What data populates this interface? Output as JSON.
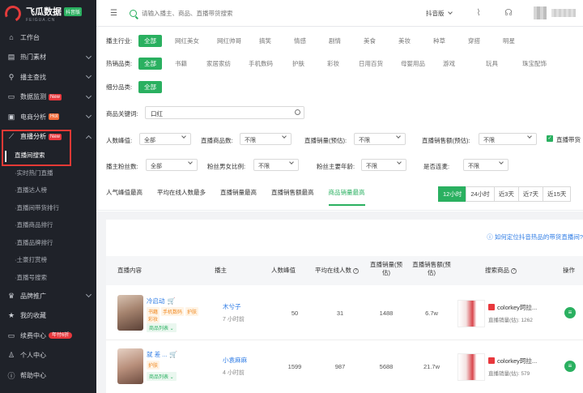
{
  "logo": {
    "title": "飞瓜数据",
    "badge": "抖音版",
    "sub": "FEIGUA.CN"
  },
  "sidebar": {
    "items": [
      {
        "label": "工作台",
        "icon": "home-icon"
      },
      {
        "label": "热门素材",
        "icon": "folder-icon"
      },
      {
        "label": "播主查找",
        "icon": "user-search-icon"
      },
      {
        "label": "数据监测",
        "icon": "monitor-icon",
        "tag": "New"
      },
      {
        "label": "电商分析",
        "icon": "cart-icon",
        "tag": "Hot"
      },
      {
        "label": "直播分析",
        "icon": "live-chart-icon",
        "tag": "New"
      }
    ],
    "sub_items": [
      "直播间搜索",
      "实时热门直播",
      "直播达人榜",
      "直播间带货排行",
      "直播商品排行",
      "直播品牌排行",
      "土豪打赏榜",
      "直播号搜索"
    ],
    "bottom_items": [
      {
        "label": "品牌推广",
        "icon": "brand-icon"
      },
      {
        "label": "我的收藏",
        "icon": "star-icon"
      },
      {
        "label": "续费中心",
        "icon": "renew-icon",
        "tag": "年付6折"
      },
      {
        "label": "个人中心",
        "icon": "person-icon"
      },
      {
        "label": "帮助中心",
        "icon": "help-icon"
      }
    ]
  },
  "header": {
    "search_placeholder": "请输入播主、商品、直播带货搜索",
    "platform": "抖音版"
  },
  "filters": {
    "industry_label": "播主行业:",
    "industries": [
      "全部",
      "网红美女",
      "网红帅哥",
      "搞笑",
      "情感",
      "剧情",
      "美食",
      "美妆",
      "种草",
      "穿搭",
      "明星"
    ],
    "category_label": "热销品类:",
    "categories": [
      "全部",
      "书籍",
      "家居家纺",
      "手机数码",
      "护肤",
      "彩妆",
      "日用百货",
      "母婴用品",
      "游戏",
      "玩具",
      "珠宝配饰"
    ],
    "subcat_label": "细分品类:",
    "subcats": [
      "全部"
    ],
    "keyword_label": "商品关键词:",
    "keyword_value": "口红",
    "row1": [
      {
        "label": "人数峰值:",
        "value": "全部"
      },
      {
        "label": "直播商品数:",
        "value": "不限"
      },
      {
        "label": "直播销量(预估):",
        "value": "不限"
      },
      {
        "label": "直播销售额(预估):",
        "value": "不限"
      }
    ],
    "checkbox_label": "直播带货",
    "row2": [
      {
        "label": "播主粉丝数:",
        "value": "全部"
      },
      {
        "label": "粉丝男女比例:",
        "value": "不限"
      },
      {
        "label": "粉丝主要年龄:",
        "value": "不限"
      },
      {
        "label": "是否连麦:",
        "value": "不限"
      }
    ]
  },
  "tabs": [
    "人气峰值最高",
    "平均在线人数最多",
    "直播销量最高",
    "直播销售额最高",
    "商品销量最高"
  ],
  "time_buttons": [
    "12小时",
    "24小时",
    "近3天",
    "近7天",
    "近15天"
  ],
  "help_link": "ⓘ 如何定位抖音热品的带货直播间?",
  "table": {
    "headers": {
      "content": "直播内容",
      "host": "播主",
      "peak": "人数峰值",
      "avg": "平均在线人数",
      "sales": "直播销量(预估)",
      "revenue": "直播销售额(预估)",
      "products": "搜索商品",
      "op": "操作"
    },
    "rows": [
      {
        "title": "冷启动",
        "tags": [
          "书籍",
          "手机数码",
          "护肤"
        ],
        "tags2": [
          "彩妆"
        ],
        "list": "商品列表",
        "host": "木兮子",
        "time": "7 小时前",
        "peak": "50",
        "avg": "31",
        "sales": "1488",
        "revenue": "6.7w",
        "product": "colorkey珂拉...",
        "product_sales": "直播销量(估): 1262"
      },
      {
        "title": "就 差 ...",
        "tags": [
          "护肤"
        ],
        "tags2": [],
        "list": "商品列表",
        "host": "小袁麻麻",
        "time": "4 小时前",
        "peak": "1599",
        "avg": "987",
        "sales": "5688",
        "revenue": "21.7w",
        "product": "colorkey珂拉...",
        "product_sales": "直播销量(估): 579"
      }
    ]
  }
}
